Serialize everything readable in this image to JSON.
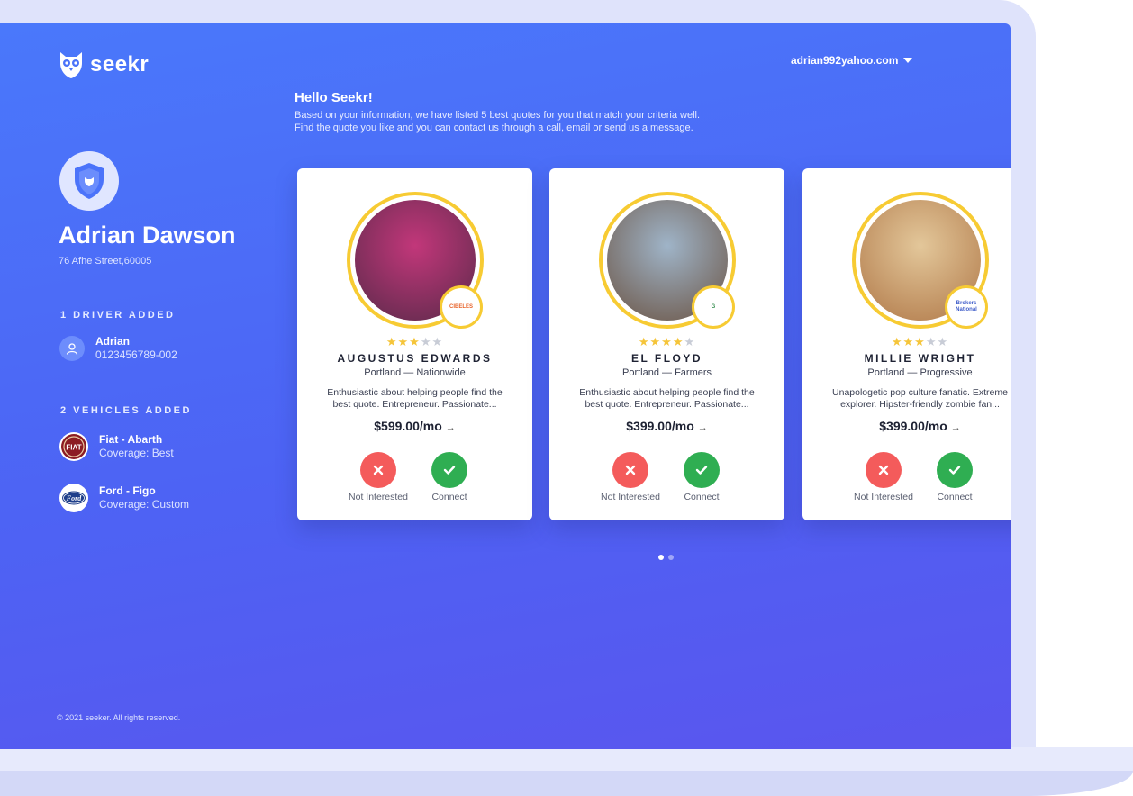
{
  "brand": {
    "name": "seekr"
  },
  "account": {
    "email": "adrian992yahoo.com"
  },
  "intro": {
    "heading": "Hello Seekr!",
    "line1": "Based on your information, we have listed 5 best quotes for you that match your criteria well.",
    "line2": "Find the quote you like and you can contact us through a call, email or send us a message."
  },
  "profile": {
    "name": "Adrian Dawson",
    "address": "76 Afhe Street,60005"
  },
  "drivers": {
    "title": "1 DRIVER ADDED",
    "items": [
      {
        "name": "Adrian",
        "phone": "0123456789-002"
      }
    ]
  },
  "vehicles": {
    "title": "2 VEHICLES ADDED",
    "items": [
      {
        "name": "Fiat - Abarth",
        "coverage": "Coverage: Best",
        "badge": "FIAT"
      },
      {
        "name": "Ford - Figo",
        "coverage": "Coverage: Custom",
        "badge": "Ford"
      }
    ]
  },
  "cards": [
    {
      "name": "AUGUSTUS EDWARDS",
      "location": "Portland  —  Nationwide",
      "desc1": "Enthusiastic about helping people find the",
      "desc2": "best quote. Entrepreneur. Passionate...",
      "price": "$599.00/mo",
      "rating": 3,
      "max_rating": 5,
      "brand": "CIBELES",
      "photo_colors": [
        "#c2377a",
        "#5a2a4a"
      ],
      "brand_color": "#e8632a"
    },
    {
      "name": "EL FLOYD",
      "location": "Portland  —  Farmers",
      "desc1": "Enthusiastic about helping people find the",
      "desc2": "best quote. Entrepreneur. Passionate...",
      "price": "$399.00/mo",
      "rating": 4,
      "max_rating": 5,
      "brand": "G",
      "photo_colors": [
        "#9fb4c8",
        "#6b5444"
      ],
      "brand_color": "#2f8a4a"
    },
    {
      "name": "MILLIE WRIGHT",
      "location": "Portland  —  Progressive",
      "desc1": "Unapologetic pop culture fanatic. Extreme",
      "desc2": "explorer. Hipster-friendly zombie fan...",
      "price": "$399.00/mo",
      "rating": 3,
      "max_rating": 5,
      "brand": "Brokers National",
      "photo_colors": [
        "#e3c79a",
        "#b07848"
      ],
      "brand_color": "#3e5cc9"
    }
  ],
  "actions": {
    "reject": "Not Interested",
    "accept": "Connect"
  },
  "pagination": {
    "pages": 2,
    "current": 1
  },
  "footer": {
    "copyright": "© 2021 seeker. All rights reserved."
  },
  "colors": {
    "accent": "#4d63f4",
    "star": "#f5c53a",
    "reject": "#f45b5b",
    "accept": "#2fae52"
  }
}
